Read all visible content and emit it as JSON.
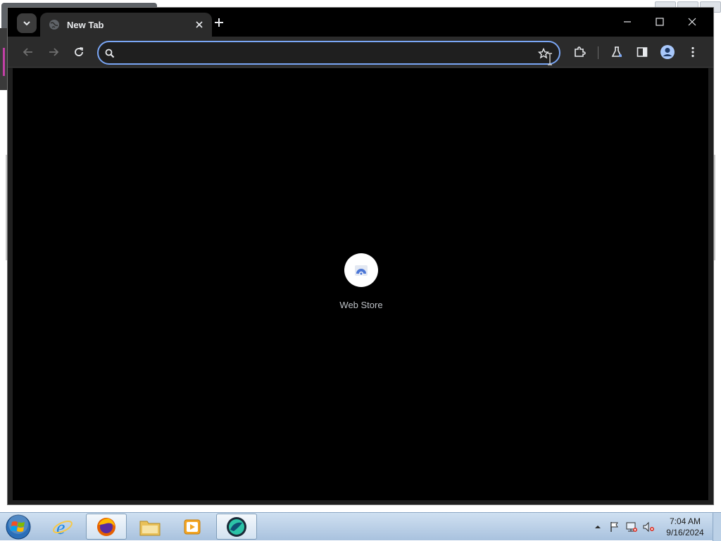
{
  "browser": {
    "tab": {
      "title": "New Tab"
    },
    "omnibox": {
      "value": "",
      "placeholder": ""
    },
    "shortcuts": [
      {
        "label": "Web Store"
      }
    ],
    "colors": {
      "accent": "#7aa6f5",
      "frame": "#000000",
      "toolbar": "#2b2b2b"
    },
    "icons": {
      "tab_search": "chevron-down-icon",
      "favicon": "globe-icon",
      "close_tab": "close-icon",
      "new_tab": "plus-icon",
      "back": "back-arrow-icon",
      "forward": "forward-arrow-icon",
      "reload": "reload-icon",
      "search": "search-icon",
      "bookmark": "star-icon",
      "extensions": "puzzle-icon",
      "labs": "flask-icon",
      "side_panel": "side-panel-icon",
      "profile": "profile-icon",
      "menu": "kebab-menu-icon"
    }
  },
  "taskbar": {
    "clock": {
      "time": "7:04 AM",
      "date": "9/16/2024"
    },
    "apps": [
      "internet-explorer",
      "firefox",
      "file-explorer",
      "media-player",
      "browser"
    ]
  }
}
